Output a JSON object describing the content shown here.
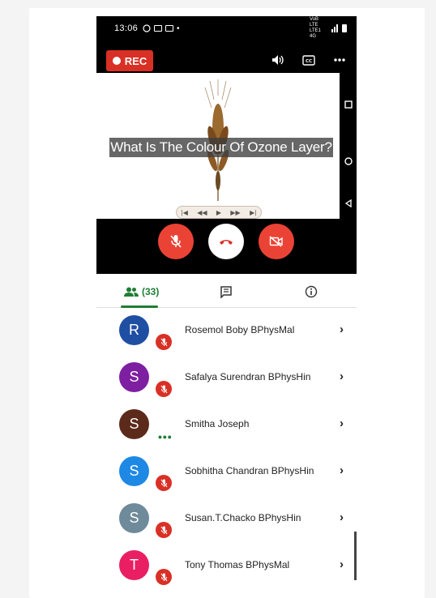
{
  "status_bar": {
    "time": "13:06",
    "network": "VoB LTE LTE1 4G"
  },
  "call": {
    "rec_label": "REC",
    "question": "What Is The Colour Of Ozone Layer?"
  },
  "tabs": {
    "people_count": "(33)"
  },
  "participants": [
    {
      "initial": "R",
      "name": "Rosemol Boby BPhysMal",
      "color": "#1f4fa3",
      "status": "muted"
    },
    {
      "initial": "S",
      "name": "Safalya Surendran BPhysHin",
      "color": "#7e1fa2",
      "status": "muted"
    },
    {
      "initial": "S",
      "name": "Smitha Joseph",
      "color": "#5c2a1a",
      "status": "speaking"
    },
    {
      "initial": "S",
      "name": "Sobhitha Chandran BPhysHin",
      "color": "#1e88e5",
      "status": "muted"
    },
    {
      "initial": "S",
      "name": "Susan.T.Chacko BPhysHin",
      "color": "#6f8a9a",
      "status": "muted"
    },
    {
      "initial": "T",
      "name": "Tony Thomas BPhysMal",
      "color": "#e91e63",
      "status": "muted"
    }
  ],
  "colors": {
    "accent": "#1e7e34",
    "danger": "#ea4335"
  },
  "icons": [
    "volume-icon",
    "captions-icon",
    "more-icon",
    "mic-off-icon",
    "end-call-icon",
    "camera-off-icon",
    "people-icon",
    "chat-icon",
    "info-icon",
    "chevron-right-icon"
  ]
}
